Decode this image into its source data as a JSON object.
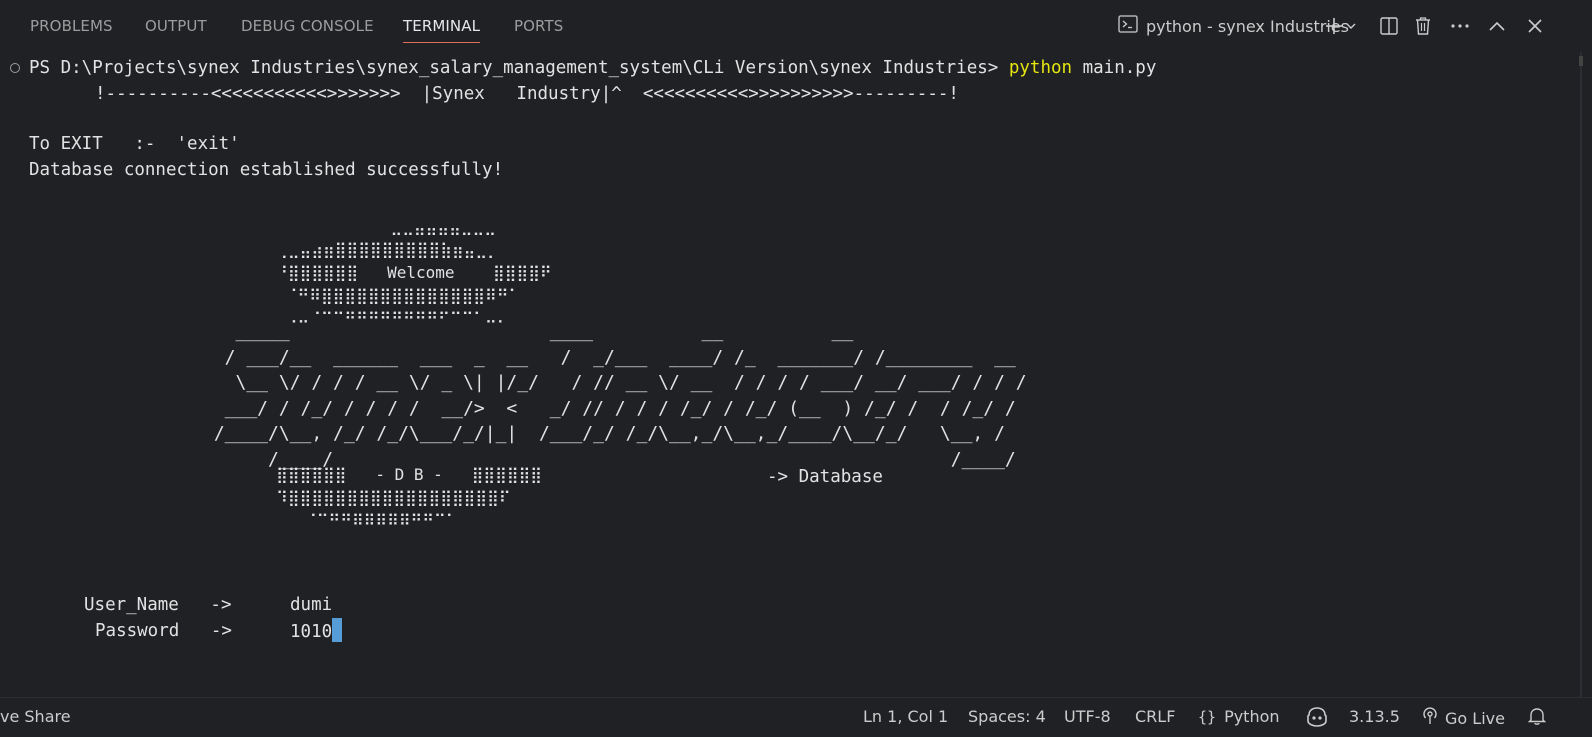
{
  "panel": {
    "tabs": [
      {
        "label": "PROBLEMS"
      },
      {
        "label": "OUTPUT"
      },
      {
        "label": "DEBUG CONSOLE"
      },
      {
        "label": "TERMINAL"
      },
      {
        "label": "PORTS"
      }
    ],
    "active_tab": "TERMINAL",
    "terminal_name": "python - synex Industries"
  },
  "terminal": {
    "prompt": "PS D:\\Projects\\synex Industries\\synex_salary_management_system\\CLi Version\\synex Industries> ",
    "command": "python",
    "command_args": " main.py",
    "banner": "!----------<<<<<<<<<<<>>>>>>>  |Synex   Industry|^  <<<<<<<<<<>>>>>>>>>>---------!",
    "exit_hint": "To EXIT   :-  'exit'",
    "db_message": "Database connection established successfully!",
    "ascii_top": "            ⠀⠀⠀⠀⣀⣀⣤⣤⣤⣤⣀⣀⣀\n     ⢀⣀⣤⣴⣶⣿⣿⣿⣿⣿⣿⣿⣿⣿⣷⣶⣤⣀⡀\n     ⠘⣿⣿⣿⣿⣿⣿   Welcome    ⣿⣿⣿⣿⠟\n      ⠈⠛⠿⣿⣿⣿⣿⣿⣿⣿⣿⣿⣿⣿⣿⣿⣿⠿⠛⠁\n      ⠠⠤⠈⠉⠉⠛⠛⠛⠛⠛⠛⠛⠛⠋⠉⠉⠁⠤⠄",
    "ascii_logo": "   _____                        ____          __          __\n  / ___/__  ______  ___  _  __   /  _/___  ____/ /_  _______/ /________  __\n   \\__ \\/ / / / __ \\/ _ \\| |/_/   / // __ \\/ __  / / / / ___/ __/ ___/ / / /\n  ___/ / /_/ / / / /  __/>  <   _/ // / / / /_/ / /_/ (__  ) /_/ /  / /_/ /\n /____/\\__, /_/ /_/\\___/_/|_|  /___/_/ /_/\\__,_/\\__,_/____/\\__/_/   \\__, /\n      /____/                                                         /____/",
    "ascii_bottom": "     ⣿⣿⣿⣿⣿⣿   - D B -   ⣿⣿⣿⣿⣿⣿\n     ⠹⣿⣿⣿⣿⣿⣿⣿⣿⣿⣿⣿⣿⣿⣿⣿⣿⣿⣿⠏\n        ⠈⠉⠛⠛⠿⠿⠿⠿⠿⠛⠛⠉⠁",
    "db_arrow": "-> Database",
    "username_label": "User_Name   ->",
    "username_value": "dumi",
    "password_label": "Password   ->",
    "password_value": "1010"
  },
  "statusbar": {
    "live_share": "ve Share",
    "position": "Ln 1, Col 1",
    "spaces": "Spaces: 4",
    "encoding": "UTF-8",
    "eol": "CRLF",
    "language": "Python",
    "python_version": "3.13.5",
    "go_live": "Go Live"
  },
  "colors": {
    "background": "#1f2125",
    "command_yellow": "#e5e510",
    "cursor_blue": "#569cd6",
    "active_tab_underline": "#e06c5a"
  }
}
